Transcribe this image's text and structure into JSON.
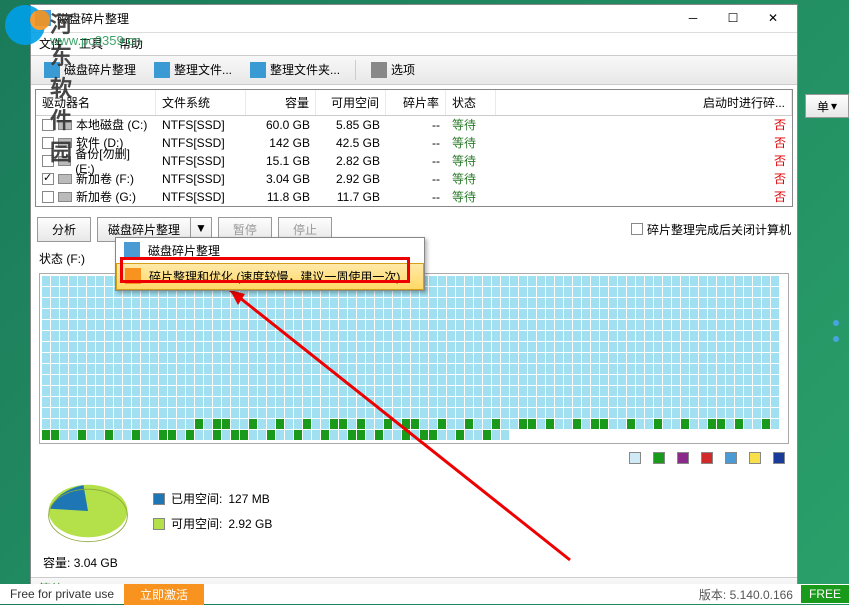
{
  "watermark": {
    "text": "河东软件园",
    "url": "www.pc0359.cn"
  },
  "window": {
    "title": "磁盘碎片整理",
    "menu": {
      "file": "文件",
      "tools": "工具",
      "help": "帮助"
    },
    "toolbar": {
      "defrag": "磁盘碎片整理",
      "arrange_files": "整理文件...",
      "arrange_folders": "整理文件夹...",
      "options": "选项"
    },
    "grid": {
      "headers": {
        "name": "驱动器名",
        "fs": "文件系统",
        "cap": "容量",
        "free": "可用空间",
        "frag": "碎片率",
        "status": "状态",
        "start": "启动时进行碎..."
      },
      "rows": [
        {
          "checked": false,
          "name": "本地磁盘 (C:)",
          "fs": "NTFS[SSD]",
          "cap": "60.0 GB",
          "free": "5.85 GB",
          "frag": "--",
          "status": "等待",
          "start": "否"
        },
        {
          "checked": false,
          "name": "软件 (D:)",
          "fs": "NTFS[SSD]",
          "cap": "142 GB",
          "free": "42.5 GB",
          "frag": "--",
          "status": "等待",
          "start": "否"
        },
        {
          "checked": false,
          "name": "备份[勿删] (E:)",
          "fs": "NTFS[SSD]",
          "cap": "15.1 GB",
          "free": "2.82 GB",
          "frag": "--",
          "status": "等待",
          "start": "否"
        },
        {
          "checked": true,
          "name": "新加卷 (F:)",
          "fs": "NTFS[SSD]",
          "cap": "3.04 GB",
          "free": "2.92 GB",
          "frag": "--",
          "status": "等待",
          "start": "否"
        },
        {
          "checked": false,
          "name": "新加卷 (G:)",
          "fs": "NTFS[SSD]",
          "cap": "11.8 GB",
          "free": "11.7 GB",
          "frag": "--",
          "status": "等待",
          "start": "否"
        }
      ]
    },
    "actions": {
      "analyze": "分析",
      "defrag_main": "磁盘碎片整理",
      "pause": "暂停",
      "stop": "停止",
      "shutdown_after": "碎片整理完成后关闭计算机"
    },
    "dropdown": {
      "item1": "磁盘碎片整理",
      "item2": "碎片整理和优化 (速度较慢，建议一周使用一次)"
    },
    "status_label": "状态 (F:)",
    "space": {
      "used_label": "已用空间:",
      "used_val": "127 MB",
      "free_label": "可用空间:",
      "free_val": "2.92 GB",
      "cap_label": "容量:",
      "cap_val": "3.04 GB"
    },
    "statusbar": {
      "wait": "等待"
    }
  },
  "bottom": {
    "private": "Free for private use",
    "activate": "立即激活",
    "version": "版本:  5.140.0.166",
    "free": "FREE"
  },
  "side_tab": "单",
  "chart_data": {
    "type": "pie",
    "title": "",
    "series": [
      {
        "name": "已用空间",
        "value": 127,
        "unit": "MB",
        "color": "#1e77b4"
      },
      {
        "name": "可用空间",
        "value": 2990,
        "unit": "MB",
        "color": "#b4e04a"
      }
    ]
  }
}
